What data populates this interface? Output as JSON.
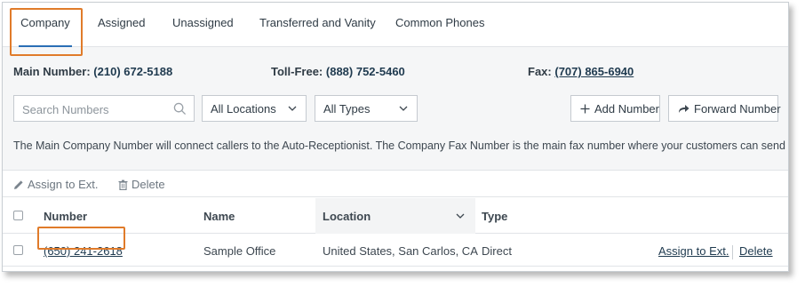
{
  "tabs": [
    {
      "label": "Company",
      "active": true
    },
    {
      "label": "Assigned",
      "active": false
    },
    {
      "label": "Unassigned",
      "active": false
    },
    {
      "label": "Transferred and Vanity",
      "active": false
    },
    {
      "label": "Common Phones",
      "active": false
    }
  ],
  "numbers": {
    "main_label": "Main Number:",
    "main_value": "(210) 672-5188",
    "tollfree_label": "Toll-Free:",
    "tollfree_value": "(888) 752-5460",
    "fax_label": "Fax:",
    "fax_value": "(707) 865-6940"
  },
  "filters": {
    "search_placeholder": "Search Numbers",
    "location_selected": "All Locations",
    "type_selected": "All Types",
    "add_number_label": "Add Number",
    "forward_number_label": "Forward Number"
  },
  "info_text": "The Main Company Number will connect callers to the Auto-Receptionist. The Company Fax Number is the main fax number where your customers can send faxes.",
  "actions": {
    "assign_label": "Assign to Ext.",
    "delete_label": "Delete"
  },
  "table": {
    "columns": [
      "Number",
      "Name",
      "Location",
      "Type"
    ],
    "rows": [
      {
        "number": "(650) 241-2618",
        "name": "Sample Office",
        "location": "United States, San Carlos, CA",
        "type": "Direct",
        "assign_link": "Assign to Ext.",
        "delete_link": "Delete"
      }
    ]
  },
  "colors": {
    "accent_blue": "#2a6eb5",
    "highlight_orange": "#e07b2a",
    "panel_bg": "#f5f6f7"
  },
  "icons": [
    "search-icon",
    "chevron-down-icon",
    "plus-icon",
    "forward-arrow-icon",
    "pencil-icon",
    "trash-icon"
  ]
}
